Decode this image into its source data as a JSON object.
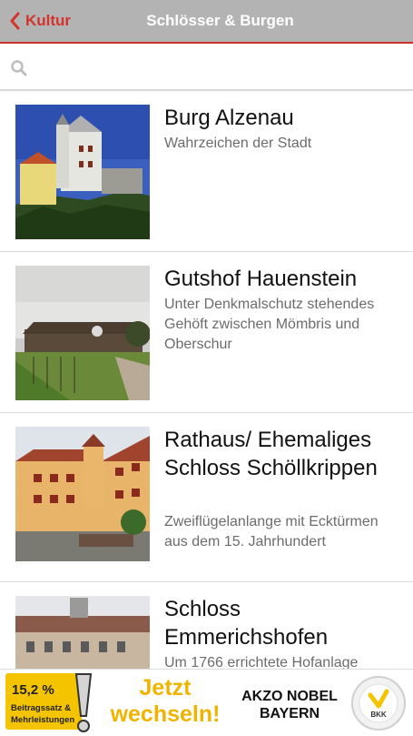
{
  "navbar": {
    "back_label": "Kultur",
    "title": "Schlösser & Burgen"
  },
  "search": {
    "placeholder": ""
  },
  "items": [
    {
      "title": "Burg Alzenau",
      "subtitle": "Wahrzeichen der Stadt"
    },
    {
      "title": "Gutshof Hauenstein",
      "subtitle": "Unter Denkmalschutz stehendes Gehöft zwischen Mömbris und Oberschur"
    },
    {
      "title": "Rathaus/ Ehemaliges Schloss Schöllkrippen",
      "subtitle": "Zweiflügelanlange mit Ecktürmen aus dem 15. Jahrhundert"
    },
    {
      "title": "Schloss Emmerichshofen",
      "subtitle": "Um 1766 errichtete Hofanlage"
    }
  ],
  "ad": {
    "rate": "15,2 %",
    "rate_caption_1": "Beitragssatz &",
    "rate_caption_2": "Mehrleistungen",
    "cta_line1": "Jetzt",
    "cta_line2": "wechseln!",
    "brand_line1": "AKZO NOBEL",
    "brand_line2": "BAYERN",
    "logo_text": "BKK"
  },
  "colors": {
    "accent": "#d4342c",
    "navbar_bg": "#b3b3b3",
    "subtitle": "#6c6c6c",
    "ad_yellow": "#f4c400"
  }
}
